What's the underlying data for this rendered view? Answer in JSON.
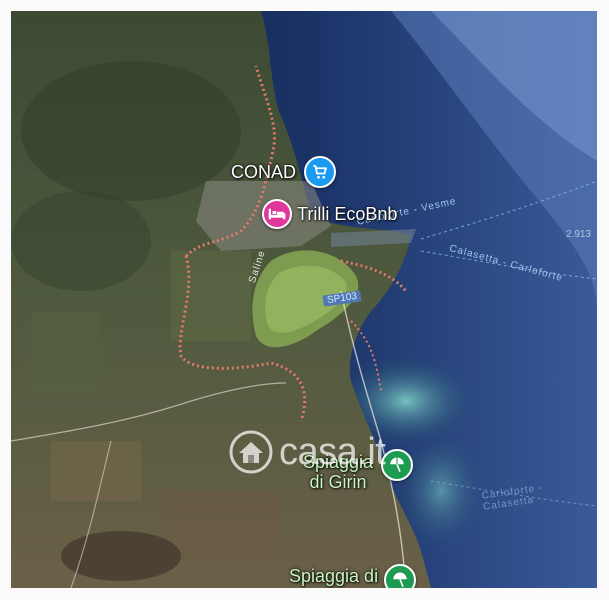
{
  "map": {
    "pois": [
      {
        "id": "conad",
        "label": "CONAD",
        "icon": "shopping-cart-icon",
        "color": "#1a9af0"
      },
      {
        "id": "trilli",
        "label": "Trilli EcoBnb",
        "icon": "bed-icon",
        "color": "#e0379a"
      },
      {
        "id": "girin",
        "label_line1": "Spiaggia",
        "label_line2": "di Girin",
        "icon": "beach-umbrella-icon",
        "color": "#1e9b52"
      },
      {
        "id": "spiaggia2",
        "label_line1": "Spiaggia di",
        "icon": "beach-umbrella-icon",
        "color": "#1e9b52"
      }
    ],
    "road_labels": {
      "route_a": "Carloforte - Vesme",
      "route_b": "Calasetta - Carloforte",
      "route_c": "Carloforte - Calasetta",
      "road_sp": "SP103",
      "lake": "Saline",
      "corner_num": "2.913"
    },
    "watermark": "casa.it",
    "colors": {
      "sea_deep": "#1b2e5c",
      "sea_shallow": "#4fb4b4",
      "land": "#4a5a3c",
      "road_dots": "#e07a6a"
    }
  }
}
